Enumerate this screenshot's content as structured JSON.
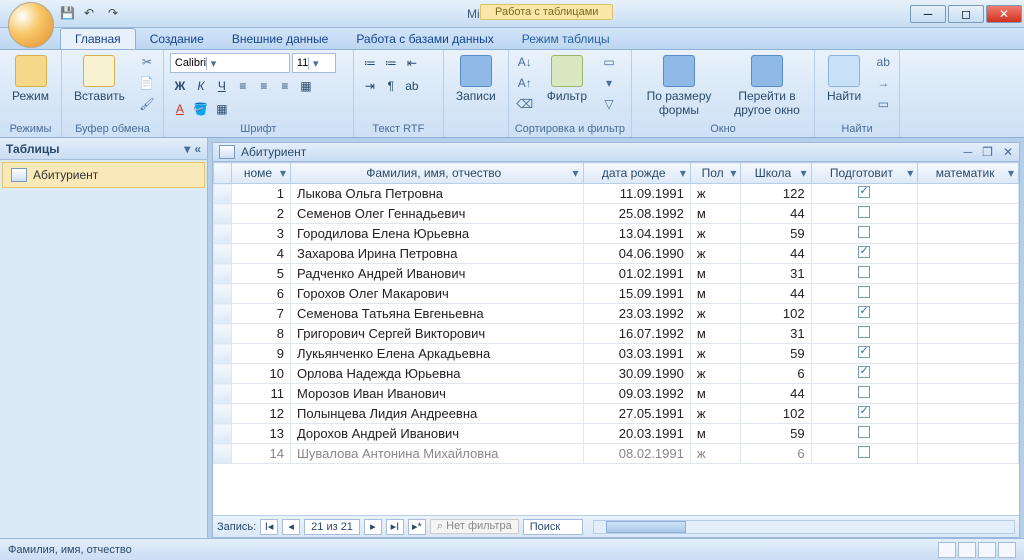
{
  "app_title": "Microsoft Access",
  "context_tab_header": "Работа с таблицами",
  "tabs": [
    "Главная",
    "Создание",
    "Внешние данные",
    "Работа с базами данных"
  ],
  "context_tab": "Режим таблицы",
  "active_tab": 0,
  "ribbon": {
    "groups": {
      "views": {
        "label": "Режимы",
        "btn": "Режим"
      },
      "clipboard": {
        "label": "Буфер обмена",
        "btn": "Вставить"
      },
      "font": {
        "label": "Шрифт",
        "family": "Calibri",
        "size": "11"
      },
      "rtf": {
        "label": "Текст RTF"
      },
      "records": {
        "label": "Записи",
        "btn": "Записи"
      },
      "sortfilter": {
        "label": "Сортировка и фильтр",
        "btn": "Фильтр"
      },
      "window": {
        "label": "Окно",
        "btn1": "По размеру формы",
        "btn2": "Перейти в другое окно"
      },
      "find": {
        "label": "Найти",
        "btn": "Найти"
      }
    }
  },
  "nav": {
    "header": "Таблицы",
    "items": [
      "Абитуриент"
    ]
  },
  "doc_title": "Абитуриент",
  "columns": [
    "номе",
    "Фамилия, имя, отчество",
    "дата рожде",
    "Пол",
    "Школа",
    "Подготовит",
    "математик"
  ],
  "rows": [
    {
      "n": 1,
      "fio": "Лыкова Ольга Петровна",
      "dob": "11.09.1991",
      "sex": "ж",
      "school": 122,
      "prep": true
    },
    {
      "n": 2,
      "fio": "Семенов Олег Геннадьевич",
      "dob": "25.08.1992",
      "sex": "м",
      "school": 44,
      "prep": false
    },
    {
      "n": 3,
      "fio": "Городилова Елена Юрьевна",
      "dob": "13.04.1991",
      "sex": "ж",
      "school": 59,
      "prep": false
    },
    {
      "n": 4,
      "fio": "Захарова Ирина Петровна",
      "dob": "04.06.1990",
      "sex": "ж",
      "school": 44,
      "prep": true
    },
    {
      "n": 5,
      "fio": "Радченко Андрей Иванович",
      "dob": "01.02.1991",
      "sex": "м",
      "school": 31,
      "prep": false
    },
    {
      "n": 6,
      "fio": "Горохов Олег Макарович",
      "dob": "15.09.1991",
      "sex": "м",
      "school": 44,
      "prep": false
    },
    {
      "n": 7,
      "fio": "Семенова Татьяна Евгеньевна",
      "dob": "23.03.1992",
      "sex": "ж",
      "school": 102,
      "prep": true
    },
    {
      "n": 8,
      "fio": "Григорович Сергей Викторович",
      "dob": "16.07.1992",
      "sex": "м",
      "school": 31,
      "prep": false
    },
    {
      "n": 9,
      "fio": "Лукьянченко Елена Аркадьевна",
      "dob": "03.03.1991",
      "sex": "ж",
      "school": 59,
      "prep": true
    },
    {
      "n": 10,
      "fio": "Орлова Надежда Юрьевна",
      "dob": "30.09.1990",
      "sex": "ж",
      "school": 6,
      "prep": true
    },
    {
      "n": 11,
      "fio": "Морозов Иван Иванович",
      "dob": "09.03.1992",
      "sex": "м",
      "school": 44,
      "prep": false
    },
    {
      "n": 12,
      "fio": "Полынцева Лидия Андреевна",
      "dob": "27.05.1991",
      "sex": "ж",
      "school": 102,
      "prep": true
    },
    {
      "n": 13,
      "fio": "Дорохов Андрей Иванович",
      "dob": "20.03.1991",
      "sex": "м",
      "school": 59,
      "prep": false
    },
    {
      "n": 14,
      "fio": "Шувалова Антонина Михайловна",
      "dob": "08.02.1991",
      "sex": "ж",
      "school": 6,
      "prep": false
    }
  ],
  "record_nav": {
    "label": "Запись:",
    "pos": "21 из 21",
    "filter": "Нет фильтра",
    "search": "Поиск"
  },
  "status": "Фамилия, имя, отчество"
}
